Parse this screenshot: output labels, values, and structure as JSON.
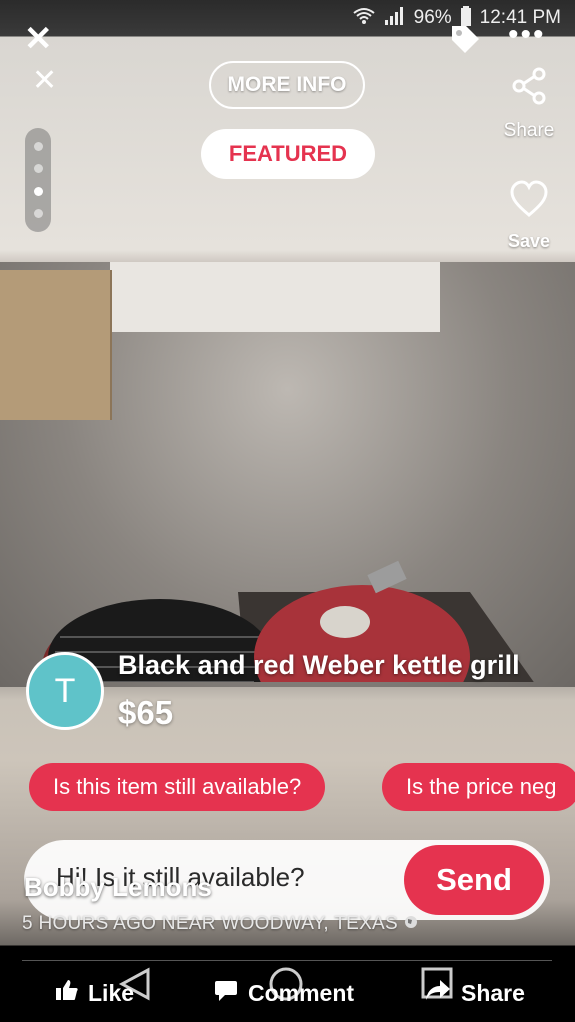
{
  "status_bar": {
    "battery": "96%",
    "time": "12:41 PM"
  },
  "header": {
    "more_info_label": "MORE INFO",
    "featured_label": "FEATURED",
    "share_label": "Share",
    "save_label": "Save"
  },
  "listing": {
    "avatar_initial": "T",
    "title": "Black and red Weber kettle grill",
    "price": "$65",
    "seller_name": "Bobby Lemons",
    "meta": "5 HOURS AGO NEAR WOODWAY, TEXAS"
  },
  "quick_replies": [
    "Is this item still available?",
    "Is the price neg"
  ],
  "message": {
    "text": "Hi! Is it still available?",
    "send_label": "Send"
  },
  "actions": {
    "like": "Like",
    "comment": "Comment",
    "share": "Share"
  },
  "colors": {
    "accent": "#e5334f",
    "avatar": "#5fc3c9"
  },
  "grill_logo": "weber"
}
